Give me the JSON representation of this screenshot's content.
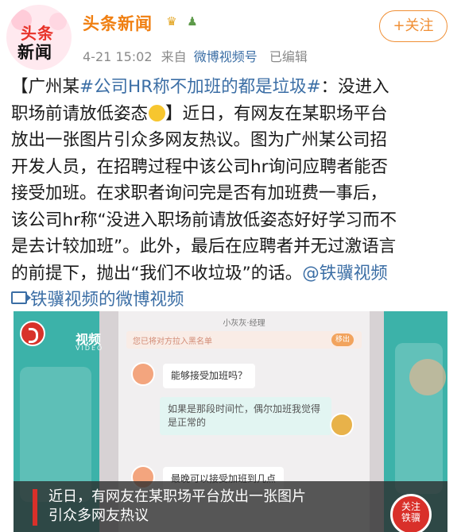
{
  "account": {
    "avatar_line1": "头条",
    "avatar_line2": "新闻",
    "name": "头条新闻",
    "badge_icons": [
      "crown-icon",
      "person-icon"
    ],
    "time": "4-21 15:02",
    "source_prefix": "来自",
    "source": "微博视频号",
    "edited": "已编辑",
    "follow_label": "+关注"
  },
  "post": {
    "l1_a": "【广州某",
    "l1_hashtag": "#公司HR称不加班的都是垃圾#",
    "l1_b": "：没进入",
    "l2_a": "职场前请放低姿态",
    "l2_b": "】近日，有网友在某职场平台",
    "l3": "放出一张图片引众多网友热议。图为广州某公司招",
    "l4": "开发人员，在招聘过程中该公司hr询问应聘者能否",
    "l5": "接受加班。在求职者询问完是否有加班费一事后，",
    "l6": "该公司hr称“没进入职场前请放低姿态好好学习而不",
    "l7": "是去计较加班”。此外，最后在应聘者并无过激语言",
    "l8_a": "的前提下，抛出“我们不收垃圾”的话。",
    "l8_mention": "@铁骥视频",
    "video_link": "铁骥视频的微博视频"
  },
  "video": {
    "watermark": "视频",
    "watermark_sub": "VIDEO",
    "contact_name": "小灰灰·经理",
    "blacklist_notice": "您已将对方拉入黑名单",
    "blacklist_btn": "移出",
    "msg1": "能够接受加班吗？",
    "msg2": "如果是那段时间忙，偶尔加班我觉得是正常的",
    "msg3": "最晚可以接受加班到几点",
    "caption_line1": "近日，有网友在某职场平台放出一张图片",
    "caption_line2": "引众多网友热议",
    "follow_label": "关注",
    "follow_label2": "铁骥"
  },
  "colors": {
    "accent_orange": "#f07f11",
    "link_blue": "#3b6ea5",
    "teal": "#3cb2a9",
    "brand_red": "#d9302a"
  }
}
